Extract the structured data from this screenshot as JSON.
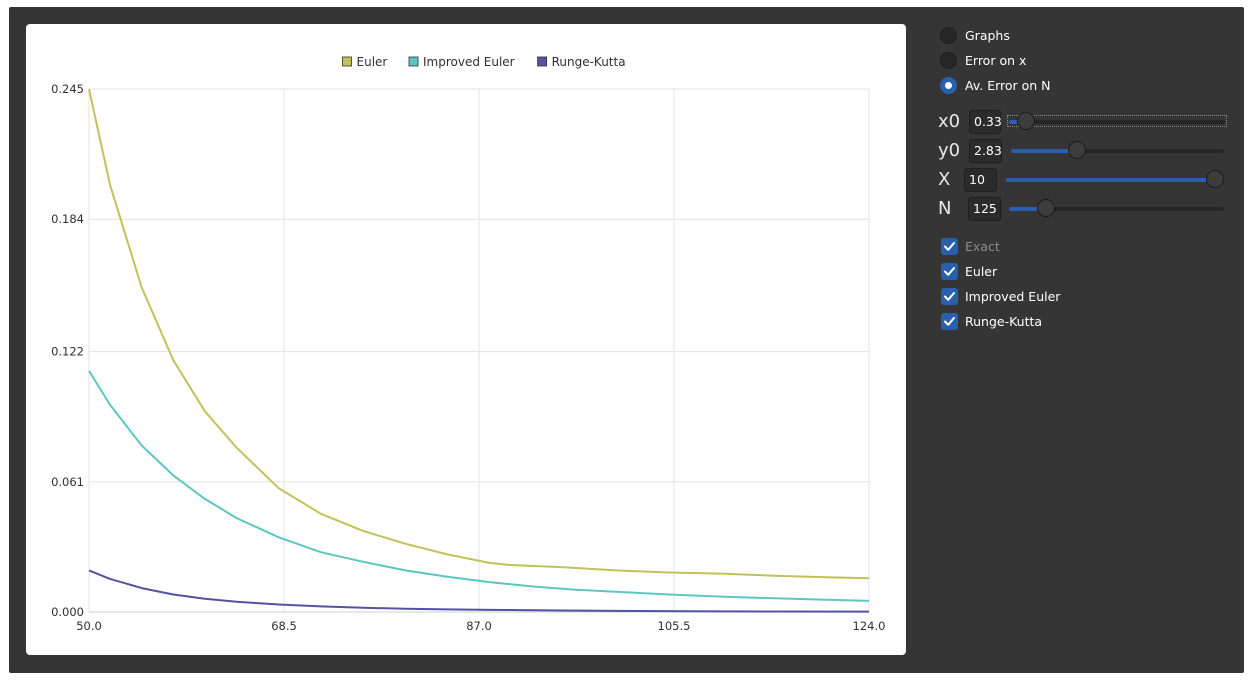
{
  "controls": {
    "modes": [
      {
        "label": "Graphs",
        "selected": false
      },
      {
        "label": "Error on x",
        "selected": false
      },
      {
        "label": "Av. Error on N",
        "selected": true
      }
    ],
    "params": [
      {
        "name": "x0",
        "value": "0.33",
        "slider_fraction": 0.04
      },
      {
        "name": "y0",
        "value": "2.83",
        "slider_fraction": 0.29
      },
      {
        "name": "X",
        "value": "10",
        "slider_fraction": 1.0
      },
      {
        "name": "N",
        "value": "125",
        "slider_fraction": 0.14
      }
    ],
    "checks": [
      {
        "label": "Exact",
        "checked": true,
        "enabled": false
      },
      {
        "label": "Euler",
        "checked": true,
        "enabled": true
      },
      {
        "label": "Improved Euler",
        "checked": true,
        "enabled": true
      },
      {
        "label": "Runge-Kutta",
        "checked": true,
        "enabled": true
      }
    ],
    "accent_color": "#2a5fb0"
  },
  "chart_data": {
    "type": "line",
    "x_ticks": [
      "50.0",
      "68.5",
      "87.0",
      "105.5",
      "124.0"
    ],
    "y_ticks": [
      "0.000",
      "0.061",
      "0.122",
      "0.184",
      "0.245"
    ],
    "xlim": [
      50.0,
      124.0
    ],
    "ylim": [
      0.0,
      0.245
    ],
    "grid": true,
    "legend_position": "top-center",
    "series": [
      {
        "name": "Euler",
        "color": "#c3c15a",
        "x": [
          50,
          52,
          55,
          58,
          61,
          64,
          68,
          72,
          76,
          80,
          84,
          88,
          90,
          95,
          100,
          105,
          110,
          115,
          120,
          124
        ],
        "y": [
          0.245,
          0.2,
          0.152,
          0.118,
          0.094,
          0.077,
          0.058,
          0.046,
          0.038,
          0.032,
          0.027,
          0.023,
          0.022,
          0.021,
          0.0195,
          0.0185,
          0.018,
          0.017,
          0.0163,
          0.0158
        ]
      },
      {
        "name": "Improved Euler",
        "color": "#5ec6c1",
        "x": [
          50,
          52,
          55,
          58,
          61,
          64,
          68,
          72,
          76,
          80,
          84,
          88,
          92,
          96,
          100,
          105,
          110,
          115,
          120,
          124
        ],
        "y": [
          0.113,
          0.097,
          0.078,
          0.064,
          0.053,
          0.044,
          0.035,
          0.028,
          0.0235,
          0.0195,
          0.0165,
          0.014,
          0.012,
          0.0105,
          0.0095,
          0.0082,
          0.0072,
          0.0064,
          0.0057,
          0.0052
        ]
      },
      {
        "name": "Runge-Kutta",
        "color": "#5552a6",
        "x": [
          50,
          52,
          55,
          58,
          61,
          64,
          68,
          72,
          76,
          80,
          84,
          88,
          95,
          100,
          110,
          124
        ],
        "y": [
          0.0195,
          0.0155,
          0.0112,
          0.0082,
          0.0062,
          0.0048,
          0.0035,
          0.0026,
          0.002,
          0.0015,
          0.0012,
          0.001,
          0.0007,
          0.0005,
          0.0003,
          0.0002
        ]
      }
    ]
  }
}
